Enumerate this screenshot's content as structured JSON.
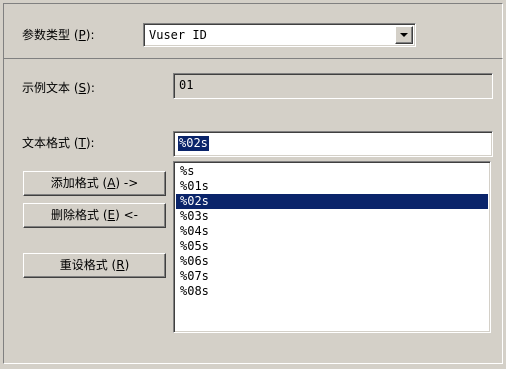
{
  "param_type": {
    "label_text": "参数类型",
    "label_key": "(P)",
    "label_key_letter": "P",
    "value": "Vuser ID"
  },
  "example_text": {
    "label_text": "示例文本",
    "label_key_letter": "S",
    "value": "01"
  },
  "text_format": {
    "label_text": "文本格式",
    "label_key_letter": "T",
    "value": "%02s"
  },
  "format_list": {
    "items": [
      "%s",
      "%01s",
      "%02s",
      "%03s",
      "%04s",
      "%05s",
      "%06s",
      "%07s",
      "%08s"
    ],
    "selected": "%02s"
  },
  "buttons": {
    "add": {
      "text": "添加格式",
      "key": "A",
      "suffix": "->"
    },
    "delete": {
      "text": "删除格式",
      "key": "E",
      "suffix": "<-"
    },
    "reset": {
      "text": "重设格式",
      "key": "R",
      "suffix": ""
    }
  },
  "colors": {
    "dialog_bg": "#d4d0c8",
    "selection_bg": "#0a246a",
    "selection_fg": "#ffffff"
  },
  "icons": {
    "combo_dropdown": "triangle-down"
  }
}
